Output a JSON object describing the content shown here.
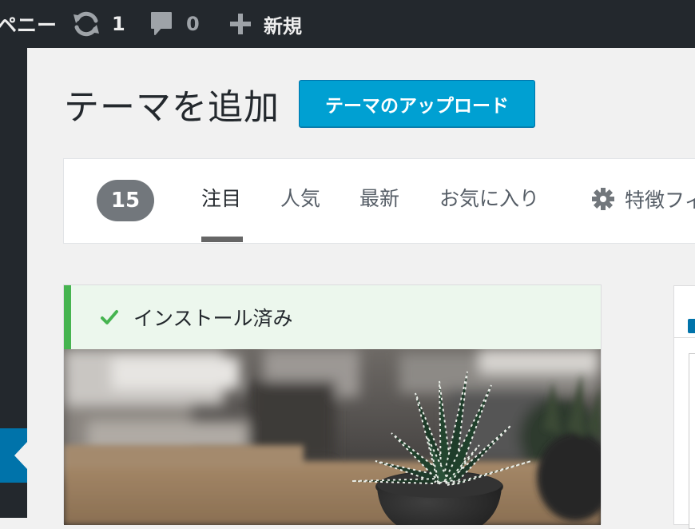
{
  "admin_bar": {
    "site_name_fragment": "ペニー",
    "updates_count": "1",
    "comments_count": "0",
    "new_label": "新規",
    "icons": [
      "updates-icon",
      "comment-icon",
      "plus-icon"
    ]
  },
  "admin_menu": {
    "current_item_color": "#0073aa"
  },
  "page": {
    "title": "テーマを追加",
    "upload_button": "テーマのアップロード"
  },
  "filter_bar": {
    "count": "15",
    "tabs": [
      {
        "label": "注目",
        "current": true
      },
      {
        "label": "人気",
        "current": false
      },
      {
        "label": "最新",
        "current": false
      },
      {
        "label": "お気に入り",
        "current": false
      }
    ],
    "feature_filter_label": "特徴フィ",
    "feature_filter_icon": "gear-icon"
  },
  "theme_card": {
    "notice_text": "インストール済み",
    "notice_icon": "checkmark-icon",
    "screenshot_subject": "plant-photo"
  },
  "colors": {
    "admin_bar_bg": "#23282d",
    "primary_button": "#00a0d2",
    "installed_notice_bg": "#ecf7ed",
    "installed_notice_accent": "#46b450",
    "count_badge_bg": "#72777c"
  }
}
